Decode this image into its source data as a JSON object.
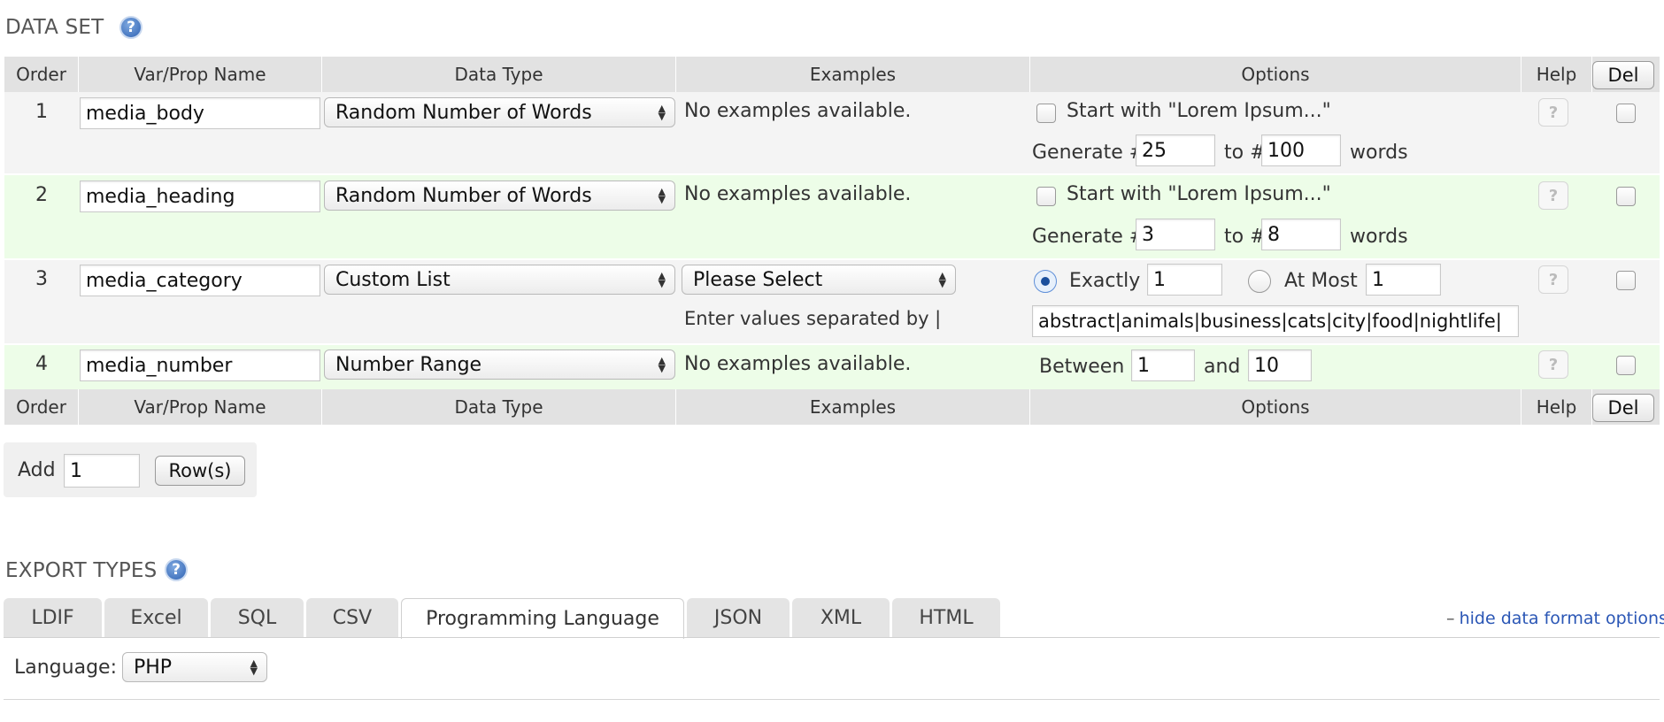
{
  "data_set": {
    "title": "DATA SET",
    "columns": {
      "order": "Order",
      "var_name": "Var/Prop Name",
      "data_type": "Data Type",
      "examples": "Examples",
      "options": "Options",
      "help": "Help",
      "del": "Del"
    },
    "rows": [
      {
        "order": "1",
        "var_name": "media_body",
        "data_type": "Random Number of Words",
        "example_text": "No examples available.",
        "lorem_label": "Start with \"Lorem Ipsum...\"",
        "generate_label": "Generate #",
        "from": "25",
        "to_label": "to #",
        "to": "100",
        "unit": "words"
      },
      {
        "order": "2",
        "var_name": "media_heading",
        "data_type": "Random Number of Words",
        "example_text": "No examples available.",
        "lorem_label": "Start with \"Lorem Ipsum...\"",
        "generate_label": "Generate #",
        "from": "3",
        "to_label": "to #",
        "to": "8",
        "unit": "words"
      },
      {
        "order": "3",
        "var_name": "media_category",
        "data_type": "Custom List",
        "example_select": "Please Select",
        "example_hint": "Enter values separated by |",
        "exactly_label": "Exactly",
        "exactly_value": "1",
        "at_most_label": "At Most",
        "at_most_value": "1",
        "values": "abstract|animals|business|cats|city|food|nightlife|"
      },
      {
        "order": "4",
        "var_name": "media_number",
        "data_type": "Number Range",
        "example_text": "No examples available.",
        "between_label": "Between",
        "from": "1",
        "and_label": "and",
        "to": "10"
      }
    ],
    "help_glyph": "?",
    "add_label": "Add",
    "add_count": "1",
    "add_button": "Row(s)"
  },
  "export_types": {
    "title": "EXPORT TYPES",
    "tabs": [
      "LDIF",
      "Excel",
      "SQL",
      "CSV",
      "Programming Language",
      "JSON",
      "XML",
      "HTML"
    ],
    "active_tab": "Programming Language",
    "hide_link": "hide data format options",
    "hide_link_prefix": "–",
    "language_label": "Language:",
    "language_value": "PHP"
  },
  "colors": {
    "header_bg": "#e2e2e2",
    "row_odd": "#f4f4f4",
    "row_even": "#edfde8",
    "link": "#2a56b5",
    "help_icon": "#2f62b3"
  }
}
